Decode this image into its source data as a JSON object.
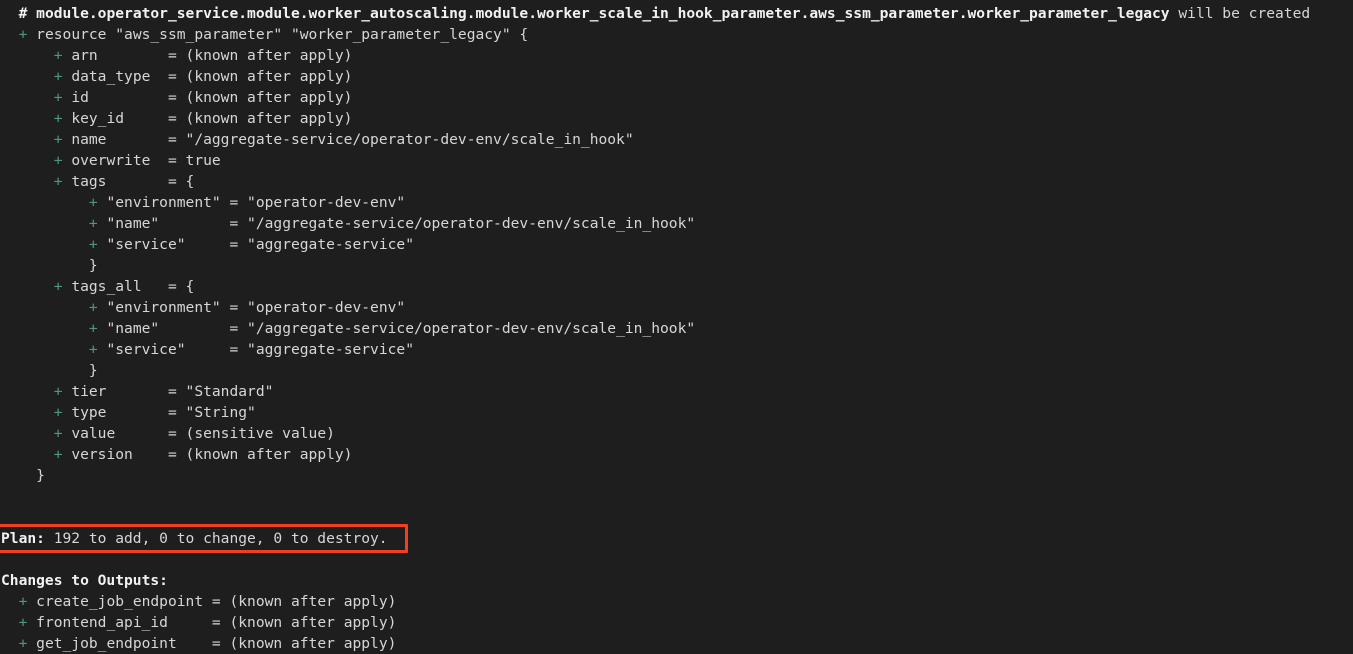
{
  "terminal": {
    "background_color": "#1e1e1e",
    "text_color": "#d6d6d6",
    "accent_add_color": "#4e9a76",
    "annotation_color": "#f04020",
    "header": {
      "hash": "#",
      "resource_address": "module.operator_service.module.worker_autoscaling.module.worker_scale_in_hook_parameter.aws_ssm_parameter.worker_parameter_legacy",
      "action_text": " will be created"
    },
    "resource_declaration": {
      "plus": "+",
      "text": "resource \"aws_ssm_parameter\" \"worker_parameter_legacy\" {"
    },
    "attributes": [
      {
        "indent": "      ",
        "plus": "+",
        "text": "arn        = (known after apply)"
      },
      {
        "indent": "      ",
        "plus": "+",
        "text": "data_type  = (known after apply)"
      },
      {
        "indent": "      ",
        "plus": "+",
        "text": "id         = (known after apply)"
      },
      {
        "indent": "      ",
        "plus": "+",
        "text": "key_id     = (known after apply)"
      },
      {
        "indent": "      ",
        "plus": "+",
        "text": "name       = \"/aggregate-service/operator-dev-env/scale_in_hook\""
      },
      {
        "indent": "      ",
        "plus": "+",
        "text": "overwrite  = true"
      },
      {
        "indent": "      ",
        "plus": "+",
        "text": "tags       = {"
      },
      {
        "indent": "          ",
        "plus": "+",
        "text": "\"environment\" = \"operator-dev-env\""
      },
      {
        "indent": "          ",
        "plus": "+",
        "text": "\"name\"        = \"/aggregate-service/operator-dev-env/scale_in_hook\""
      },
      {
        "indent": "          ",
        "plus": "+",
        "text": "\"service\"     = \"aggregate-service\""
      },
      {
        "indent": "        ",
        "plus": " ",
        "text": "}"
      },
      {
        "indent": "      ",
        "plus": "+",
        "text": "tags_all   = {"
      },
      {
        "indent": "          ",
        "plus": "+",
        "text": "\"environment\" = \"operator-dev-env\""
      },
      {
        "indent": "          ",
        "plus": "+",
        "text": "\"name\"        = \"/aggregate-service/operator-dev-env/scale_in_hook\""
      },
      {
        "indent": "          ",
        "plus": "+",
        "text": "\"service\"     = \"aggregate-service\""
      },
      {
        "indent": "        ",
        "plus": " ",
        "text": "}"
      },
      {
        "indent": "      ",
        "plus": "+",
        "text": "tier       = \"Standard\""
      },
      {
        "indent": "      ",
        "plus": "+",
        "text": "type       = \"String\""
      },
      {
        "indent": "      ",
        "plus": "+",
        "text": "value      = (sensitive value)"
      },
      {
        "indent": "      ",
        "plus": "+",
        "text": "version    = (known after apply)"
      }
    ],
    "closing_brace": {
      "indent": "    ",
      "text": "}"
    },
    "plan_summary": {
      "label": "Plan:",
      "detail": " 192 to add, 0 to change, 0 to destroy.",
      "add_count": "192",
      "change_count": "0",
      "destroy_count": "0",
      "highlighted": "true"
    },
    "outputs_header": "Changes to Outputs:",
    "outputs": [
      {
        "plus": "+",
        "text": "create_job_endpoint = (known after apply)"
      },
      {
        "plus": "+",
        "text": "frontend_api_id     = (known after apply)"
      },
      {
        "plus": "+",
        "text": "get_job_endpoint    = (known after apply)"
      }
    ]
  }
}
